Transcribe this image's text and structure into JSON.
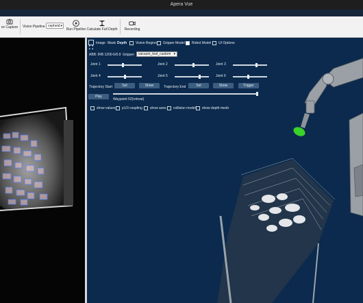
{
  "window": {
    "title": "Apera Vue"
  },
  "toolbar": {
    "save_capture": "ve Capture",
    "vision_pipeline_label": "Vision Pipeline",
    "vision_pipeline_value": "cepheid",
    "run_pipeline": "Run Pipeline",
    "calculate_full_depth": "Calculate Full Depth",
    "recording": "Recording"
  },
  "scene": {
    "tabs": {
      "image": "Image",
      "mask": "Mask",
      "depth": "Depth"
    },
    "top_checks": {
      "vision_region": "Vision Region",
      "gripper_model": "Gripper Model",
      "robot_model": "Robot Model",
      "ui_options": "UI Options"
    },
    "robot_label": "ABB: IRB 1200-5/0.9",
    "gripper_label": "Gripper:",
    "gripper_value": "vacuum_tool_custom",
    "joints": [
      "Joint 1",
      "Joint 2",
      "Joint 3",
      "Joint 4",
      "Joint 5",
      "Joint 6"
    ],
    "joint_levels": [
      0.45,
      0.55,
      0.7,
      0.5,
      0.75,
      0.45
    ],
    "trajectory_start": "Trajectory Start",
    "trajectory_end": "Trajectory End",
    "set_label": "Set",
    "show_label": "Show",
    "trigger_label": "Trigger",
    "play_label": "Play",
    "waypoint_label": "Waypoint 52(retreat)",
    "waypoint_level": 1.0,
    "bottom_checks": [
      "show values",
      "p1/3 coupling",
      "show axes",
      "collision model",
      "show depth mesh"
    ]
  }
}
